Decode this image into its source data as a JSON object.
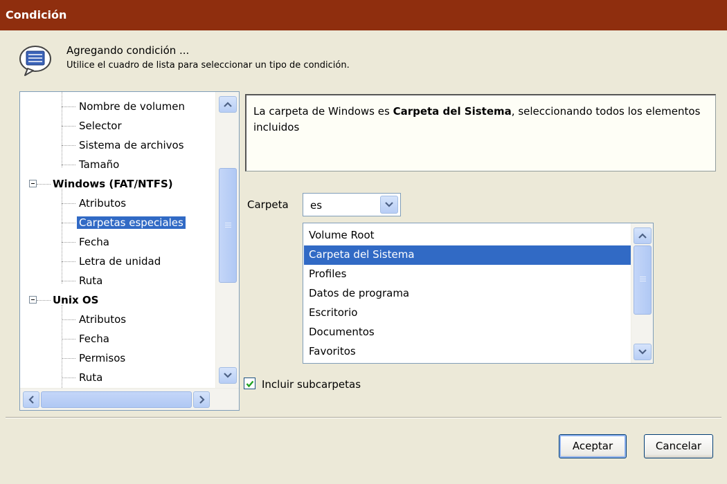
{
  "window": {
    "title": "Condición"
  },
  "header": {
    "icon": "speech-bubble-list-icon",
    "title": "Agregando condición ...",
    "subtitle": "Utilice el cuadro de lista para seleccionar un tipo de condición."
  },
  "tree": {
    "items": [
      {
        "label": "Nombre de volumen",
        "type": "child"
      },
      {
        "label": "Selector",
        "type": "child"
      },
      {
        "label": "Sistema de archivos",
        "type": "child"
      },
      {
        "label": "Tamaño",
        "type": "child"
      },
      {
        "label": "Windows (FAT/NTFS)",
        "type": "group",
        "expanded": true
      },
      {
        "label": "Atributos",
        "type": "child"
      },
      {
        "label": "Carpetas especiales",
        "type": "child",
        "selected": true
      },
      {
        "label": "Fecha",
        "type": "child"
      },
      {
        "label": "Letra de unidad",
        "type": "child"
      },
      {
        "label": "Ruta",
        "type": "child"
      },
      {
        "label": "Unix OS",
        "type": "group",
        "expanded": true
      },
      {
        "label": "Atributos",
        "type": "child"
      },
      {
        "label": "Fecha",
        "type": "child"
      },
      {
        "label": "Permisos",
        "type": "child"
      },
      {
        "label": "Ruta",
        "type": "child"
      }
    ]
  },
  "description": {
    "prefix": "La carpeta de Windows es ",
    "bold": "Carpeta del Sistema",
    "suffix": ", seleccionando todos los elementos incluidos"
  },
  "folder": {
    "label": "Carpeta",
    "operator_value": "es"
  },
  "folder_list": {
    "items": [
      {
        "label": "Volume Root"
      },
      {
        "label": "Carpeta del Sistema",
        "selected": true
      },
      {
        "label": "Profiles"
      },
      {
        "label": "Datos de programa"
      },
      {
        "label": "Escritorio"
      },
      {
        "label": "Documentos"
      },
      {
        "label": "Favoritos"
      }
    ]
  },
  "include_subfolders": {
    "label": "Incluir subcarpetas",
    "checked": true
  },
  "buttons": {
    "accept": "Aceptar",
    "cancel": "Cancelar"
  },
  "colors": {
    "titlebar": "#8F2E0E",
    "selection": "#316AC5",
    "dialog_bg": "#ECE9D8"
  }
}
